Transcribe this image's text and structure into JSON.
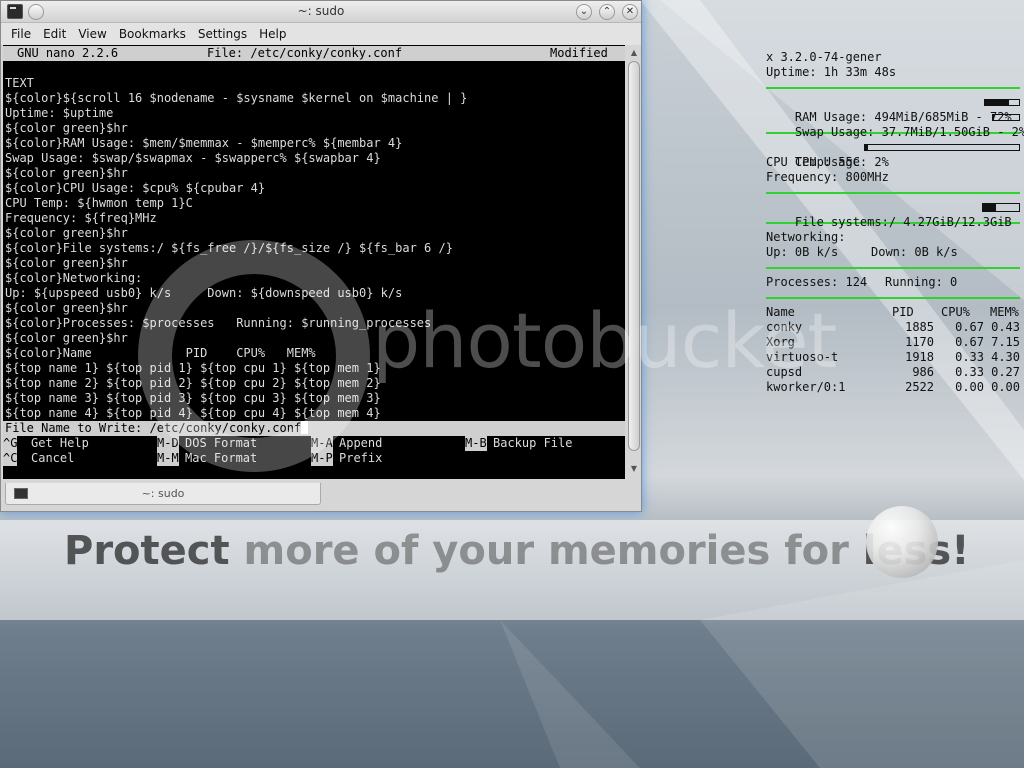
{
  "window": {
    "title": "~: sudo",
    "menu": [
      "File",
      "Edit",
      "View",
      "Bookmarks",
      "Settings",
      "Help"
    ],
    "tab_label": "~: sudo"
  },
  "nano": {
    "version": "GNU nano 2.2.6",
    "file": "File: /etc/conky/conky.conf",
    "status": "Modified",
    "lines": [
      "",
      "TEXT",
      "${color}${scroll 16 $nodename - $sysname $kernel on $machine | }",
      "Uptime: $uptime",
      "${color green}$hr",
      "${color}RAM Usage: $mem/$memmax - $memperc% ${membar 4}",
      "Swap Usage: $swap/$swapmax - $swapperc% ${swapbar 4}",
      "${color green}$hr",
      "${color}CPU Usage: $cpu% ${cpubar 4}",
      "CPU Temp: ${hwmon temp 1}C",
      "Frequency: ${freq}MHz",
      "${color green}$hr",
      "${color}File systems:/ ${fs_free /}/${fs_size /} ${fs_bar 6 /}",
      "${color green}$hr",
      "${color}Networking:",
      "Up: ${upspeed usb0} k/s     Down: ${downspeed usb0} k/s",
      "${color green}$hr",
      "${color}Processes: $processes   Running: $running_processes",
      "${color green}$hr",
      "${color}Name             PID    CPU%   MEM%",
      "${top name 1} ${top pid 1} ${top cpu 1} ${top mem 1}",
      "${top name 2} ${top pid 2} ${top cpu 2} ${top mem 2}",
      "${top name 3} ${top pid 3} ${top cpu 3} ${top mem 3}",
      "${top name 4} ${top pid 4} ${top cpu 4} ${top mem 4}"
    ],
    "prompt": "File Name to Write: /etc/conky/conky.conf",
    "shortcuts_row1": [
      {
        "key": "^G",
        "label": "Get Help"
      },
      {
        "key": "M-D",
        "label": "DOS Format"
      },
      {
        "key": "M-A",
        "label": "Append"
      },
      {
        "key": "M-B",
        "label": "Backup File"
      }
    ],
    "shortcuts_row2": [
      {
        "key": "^C",
        "label": "Cancel"
      },
      {
        "key": "M-M",
        "label": "Mac Format"
      },
      {
        "key": "M-P",
        "label": "Prefix"
      }
    ]
  },
  "conky": {
    "kernel": "x 3.2.0-74-gener",
    "uptime": "Uptime: 1h 33m 48s",
    "ram": "RAM Usage: 494MiB/685MiB - 72%",
    "ram_percent": 72,
    "swap": "Swap Usage: 37.7MiB/1.50GiB - 2%",
    "swap_percent": 2,
    "cpu": "CPU Usage: 2%",
    "cpu_percent": 2,
    "cpu_temp": "CPU Temp: 55C",
    "frequency": "Frequency: 800MHz",
    "fs": "File systems:/ 4.27GiB/12.3GiB",
    "fs_percent": 35,
    "networking": "Networking:",
    "up": "Up: 0B k/s",
    "down": "Down: 0B k/s",
    "processes": "Processes: 124",
    "running": "Running: 0",
    "headers": [
      "Name",
      "PID",
      "CPU%",
      "MEM%"
    ],
    "rows": [
      [
        "conky",
        "1885",
        "0.67",
        "0.43"
      ],
      [
        "Xorg",
        "1170",
        "0.67",
        "7.15"
      ],
      [
        "virtuoso-t",
        "1918",
        "0.33",
        "4.30"
      ],
      [
        "cupsd",
        "986",
        "0.33",
        "0.27"
      ],
      [
        "kworker/0:1",
        "2522",
        "0.00",
        "0.00"
      ]
    ]
  },
  "watermark": {
    "brand": "photobucket",
    "slogan_light": "more of your memories for ",
    "slogan_dark_start": "Protect ",
    "slogan_dark_end": "less!"
  }
}
